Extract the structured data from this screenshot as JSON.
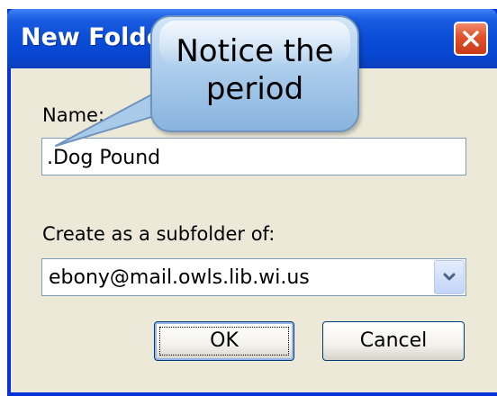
{
  "window": {
    "title": "New Folder"
  },
  "form": {
    "name_label": "Name:",
    "name_value": ".Dog Pound",
    "subfolder_label": "Create as a subfolder of:",
    "subfolder_value": "ebony@mail.owls.lib.wi.us"
  },
  "buttons": {
    "ok": "OK",
    "cancel": "Cancel"
  },
  "callout": {
    "line1": "Notice the",
    "line2": "period"
  },
  "colors": {
    "titlebar": "#0747d1",
    "dialog_bg": "#ece9d8",
    "close": "#e0502c",
    "callout": "#a6c9ea"
  },
  "icons": {
    "close": "close-icon",
    "dropdown": "chevron-down-icon"
  }
}
